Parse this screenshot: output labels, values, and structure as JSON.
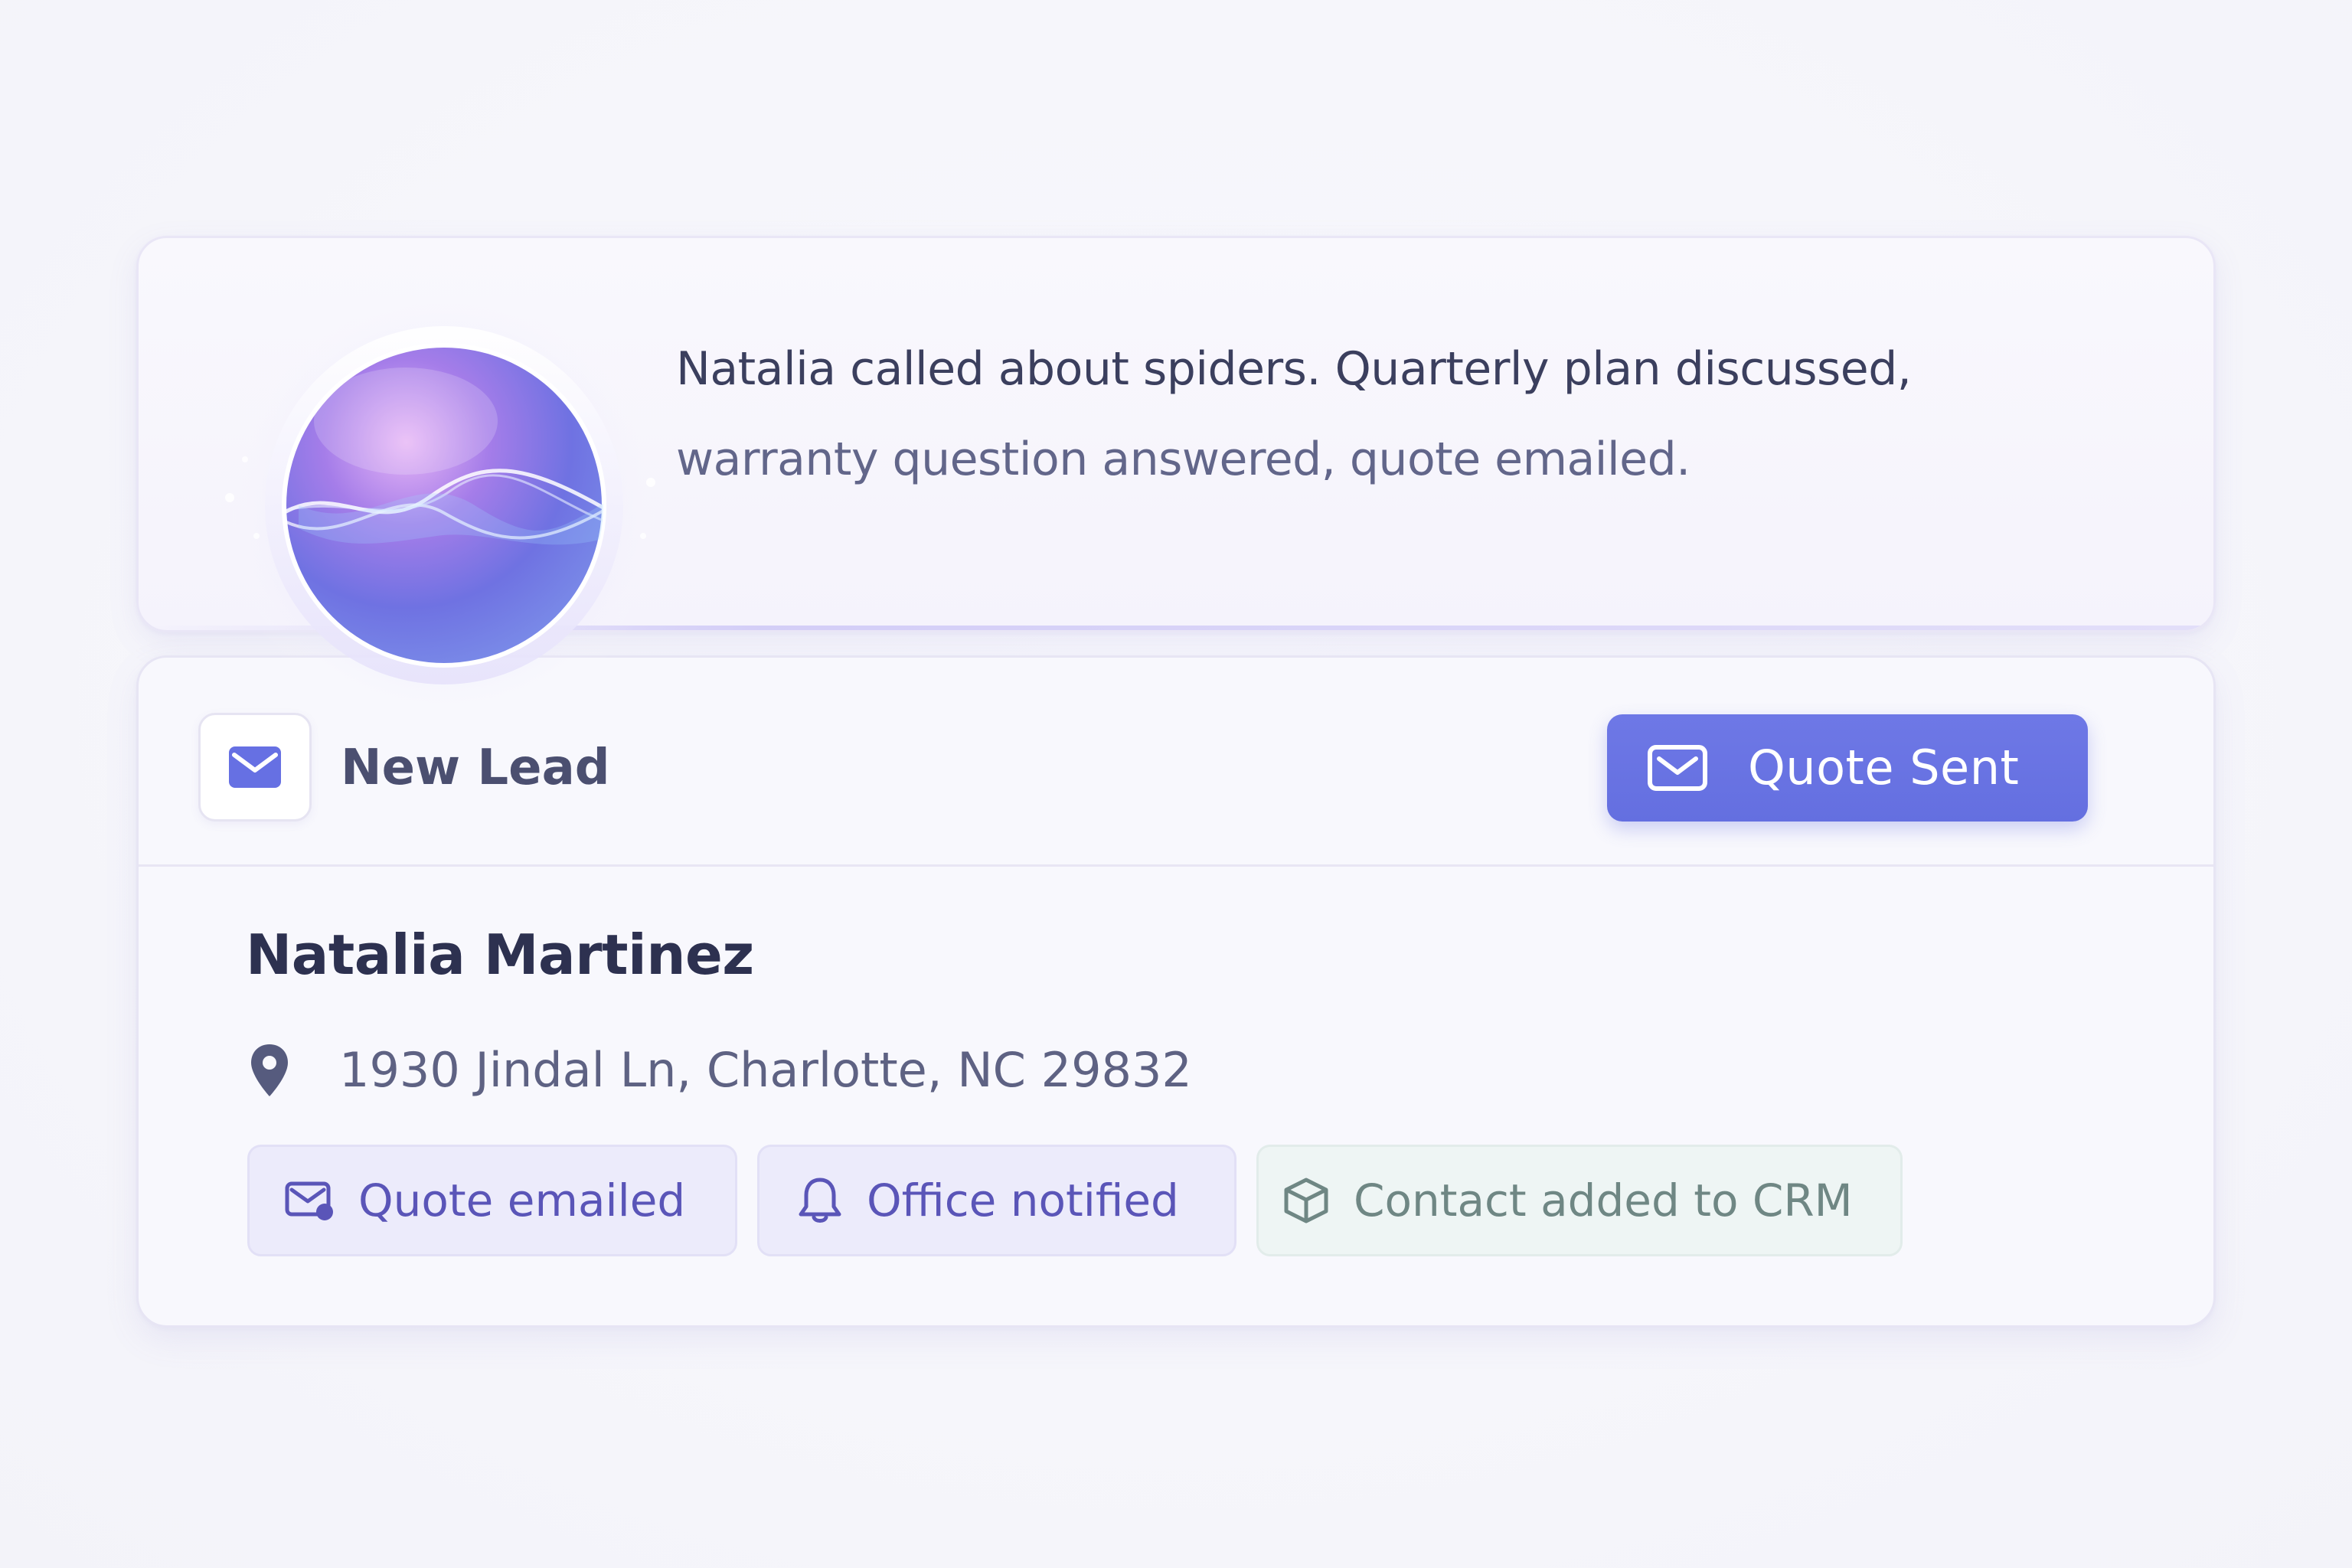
{
  "summary": {
    "line_1": "Natalia called about spiders. Quarterly plan discussed,",
    "line_2": "warranty question answered, quote emailed."
  },
  "assistant": {
    "icon": "ai-orb-icon"
  },
  "lead": {
    "type_icon": "mail-icon",
    "type_label": "New Lead",
    "status_icon": "mail-icon",
    "status_label": "Quote Sent",
    "contact_name": "Natalia Martinez",
    "address_icon": "location-pin-icon",
    "address": "1930 Jindal Ln, Charlotte, NC 29832",
    "actions": [
      {
        "icon": "mail-send-icon",
        "label": "Quote emailed"
      },
      {
        "icon": "bell-icon",
        "label": "Office notified"
      },
      {
        "icon": "cube-icon",
        "label": "Contact added to CRM"
      }
    ]
  },
  "colors": {
    "accent": "#6670e3",
    "accent_text": "#5a55b8",
    "chip_purple_bg": "#ecebfb",
    "chip_teal_bg": "#eef5f4",
    "chip_teal_text": "#6f8784",
    "heading_text": "#2d3150",
    "body_text": "#5e6283",
    "background": "#f6f6fb"
  }
}
